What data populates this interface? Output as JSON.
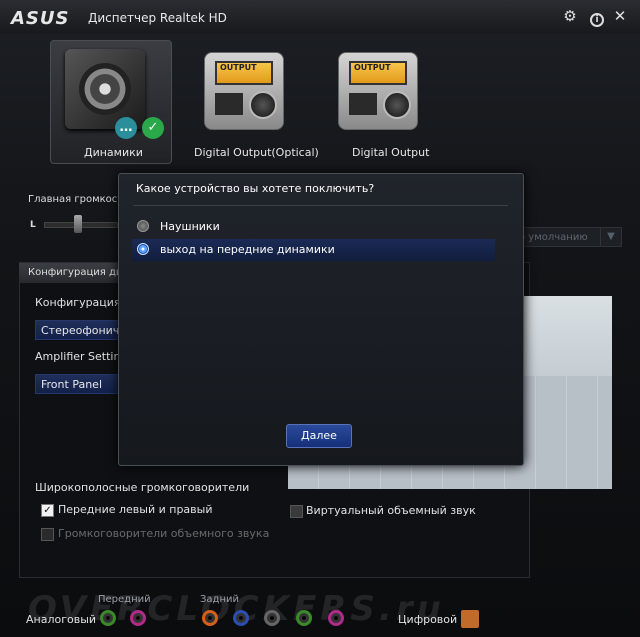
{
  "app": {
    "logo": "ASUS",
    "title": "Диспетчер Realtek HD",
    "settings_icon": "gear-icon",
    "close_icon": "close-icon"
  },
  "devices": [
    {
      "label": "Динамики",
      "selected": true
    },
    {
      "label": "Digital Output(Optical)",
      "selected": false
    },
    {
      "label": "Digital Output",
      "selected": false
    }
  ],
  "device_screen_text": "OUTPUT",
  "volume": {
    "label": "Главная громкость",
    "left_label": "L"
  },
  "default_device_label": "о умолчанию",
  "config_tab": "Конфигурация дин",
  "config_label": "Конфигурация д",
  "config_value": "Стереофониче",
  "amplifier_label": "Amplifier Setting",
  "amplifier_value": "Front Panel",
  "fullrange": {
    "title": "Широкополосные громкоговорители",
    "front_lr": {
      "label": "Передние левый и правый",
      "checked": true
    },
    "surround": {
      "label": "Громкоговорители объемного звука",
      "checked": false,
      "disabled": true
    }
  },
  "virtual_surround": {
    "label": "Виртуальный объемный звук",
    "checked": false
  },
  "bottom": {
    "analog_label": "Аналоговый",
    "front_label": "Передний",
    "rear_label": "Задний",
    "digital_label": "Цифровой",
    "watermark": "OVERCLOCKERS.ru",
    "jack_colors": {
      "front": [
        "#3a8a2a",
        "#b02a8a"
      ],
      "rear": [
        "#d2601a",
        "#2a4fb0",
        "#666666",
        "#3a8a2a",
        "#b02a8a"
      ]
    }
  },
  "dialog": {
    "title": "Какое устройство вы хотете поключить?",
    "options": [
      {
        "label": "Наушники",
        "selected": false
      },
      {
        "label": "выход на передние динамики",
        "selected": true
      }
    ],
    "next_label": "Далее"
  },
  "colors": {
    "accent_blue": "#1b2b56",
    "check_green": "#2aa84a",
    "chat_teal": "#2a8f9a"
  }
}
